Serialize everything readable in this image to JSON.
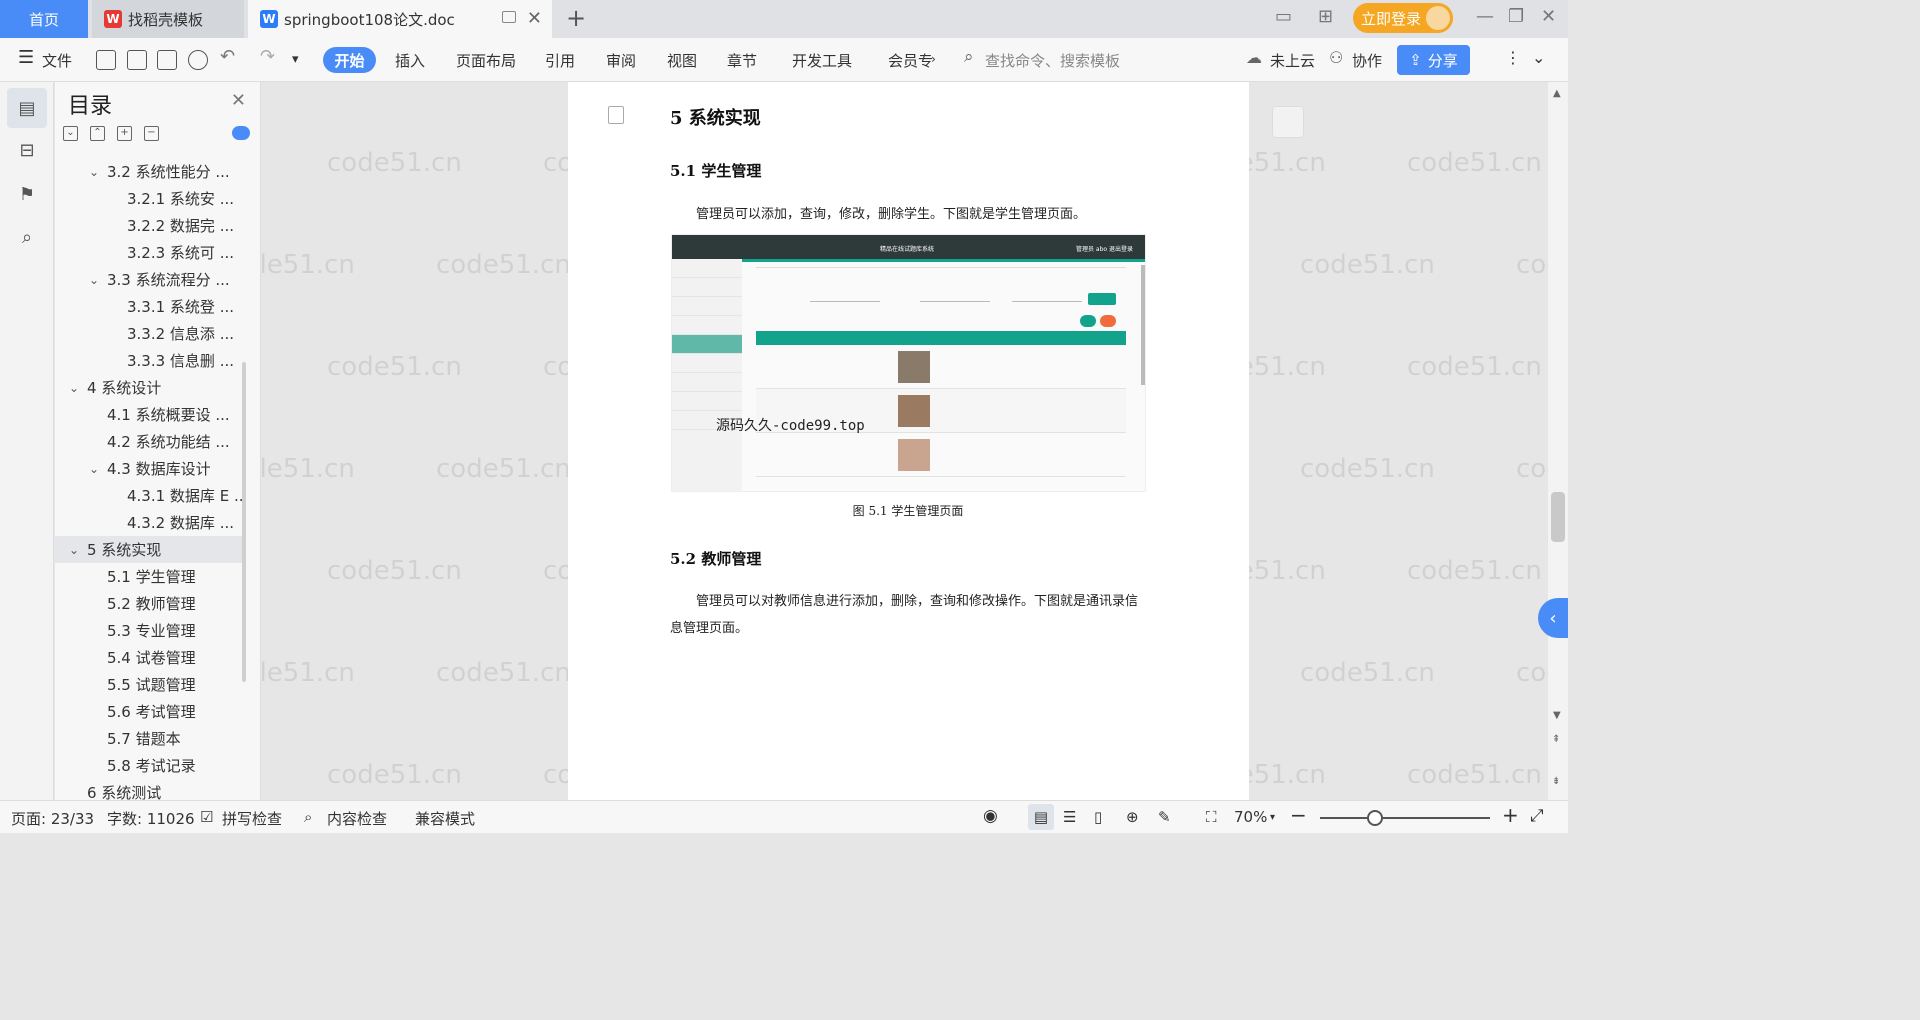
{
  "titlebar": {
    "home_tab": "首页",
    "tabs": [
      {
        "label": "找稻壳模板"
      },
      {
        "label": "springboot108论文.doc"
      }
    ],
    "login_button": "立即登录"
  },
  "ribbon": {
    "file_label": "文件",
    "menu": [
      "开始",
      "插入",
      "页面布局",
      "引用",
      "审阅",
      "视图",
      "章节",
      "开发工具",
      "会员专"
    ],
    "search_placeholder": "查找命令、搜索模板",
    "cloud_label": "未上云",
    "collab_label": "协作",
    "share_label": "分享"
  },
  "toc": {
    "title": "目录",
    "items": [
      {
        "label": "3.2 系统性能分 ...",
        "level": 2,
        "expanded": true
      },
      {
        "label": "3.2.1 系统安 ...",
        "level": 3
      },
      {
        "label": "3.2.2 数据完 ...",
        "level": 3
      },
      {
        "label": "3.2.3 系统可 ...",
        "level": 3
      },
      {
        "label": "3.3 系统流程分 ...",
        "level": 2,
        "expanded": true
      },
      {
        "label": "3.3.1 系统登 ...",
        "level": 3
      },
      {
        "label": "3.3.2 信息添 ...",
        "level": 3
      },
      {
        "label": "3.3.3 信息删 ...",
        "level": 3
      },
      {
        "label": "4 系统设计",
        "level": 1,
        "expanded": true
      },
      {
        "label": "4.1 系统概要设 ...",
        "level": 2
      },
      {
        "label": "4.2 系统功能结 ...",
        "level": 2
      },
      {
        "label": "4.3 数据库设计",
        "level": 2,
        "expanded": true
      },
      {
        "label": "4.3.1 数据库 E ...",
        "level": 3
      },
      {
        "label": "4.3.2 数据库 ...",
        "level": 3
      },
      {
        "label": "5 系统实现",
        "level": 1,
        "expanded": true,
        "selected": true
      },
      {
        "label": "5.1 学生管理",
        "level": 2
      },
      {
        "label": "5.2 教师管理",
        "level": 2
      },
      {
        "label": "5.3 专业管理",
        "level": 2
      },
      {
        "label": "5.4 试卷管理",
        "level": 2
      },
      {
        "label": "5.5 试题管理",
        "level": 2
      },
      {
        "label": "5.6 考试管理",
        "level": 2
      },
      {
        "label": "5.7 错题本",
        "level": 2
      },
      {
        "label": "5.8 考试记录",
        "level": 2
      },
      {
        "label": "6 系统测试",
        "level": 1
      }
    ]
  },
  "document": {
    "h1": "5  系统实现",
    "section1_title": "5.1  学生管理",
    "section1_text": "管理员可以添加，查询，修改，删除学生。下图就是学生管理页面。",
    "figure": {
      "app_title": "精品在线试题库系统",
      "top_right": "管理员 abo   退出登录",
      "watermark_text": "源码久久-code99.top",
      "caption": "图 5.1  学生管理页面"
    },
    "section2_title": "5.2  教师管理",
    "section2_text": "管理员可以对教师信息进行添加，删除，查询和修改操作。下图就是通讯录信息管理页面。"
  },
  "watermark": "code51.cn",
  "statusbar": {
    "page": "页面: 23/33",
    "words": "字数: 11026",
    "spell_check": "拼写检查",
    "content_check": "内容检查",
    "compat_mode": "兼容模式",
    "zoom": "70%"
  },
  "colors": {
    "accent": "#4a8cf7",
    "login": "#f5a623",
    "figure_header": "#13a38c"
  }
}
